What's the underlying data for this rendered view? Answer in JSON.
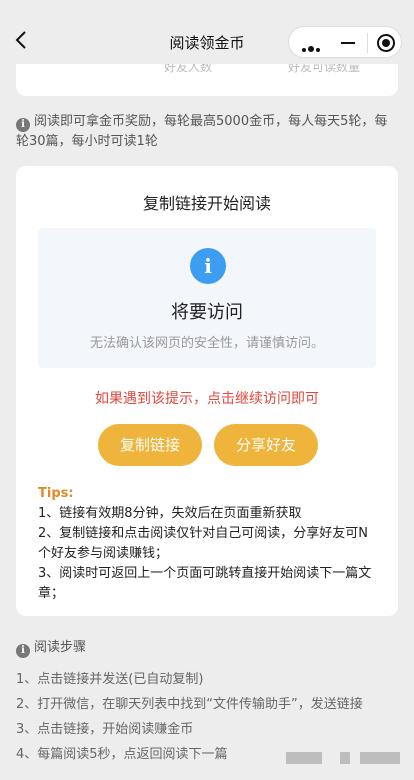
{
  "nav": {
    "title": "阅读领金币"
  },
  "stats": {
    "label_1": "好友人数",
    "label_2": "好友可读数量"
  },
  "info": {
    "text": "阅读即可拿金币奖励，每轮最高5000金币，每人每天5轮，每轮30篇，每小时可读1轮"
  },
  "card": {
    "title": "复制链接开始阅读",
    "warning": {
      "icon": "info-icon",
      "icon_glyph": "i",
      "title": "将要访问",
      "subtitle": "无法确认该网页的安全性，请谨慎访问。"
    },
    "hint": "如果遇到该提示，点击继续访问即可",
    "copy_button": "复制链接",
    "share_button": "分享好友",
    "tips_title": "Tips:",
    "tips": [
      "1、链接有效期8分钟，失效后在页面重新获取",
      "2、复制链接和点击阅读仅针对自己可阅读，分享好友可N个好友参与阅读赚钱；",
      "3、阅读时可返回上一个页面可跳转直接开始阅读下一篇文章；"
    ]
  },
  "steps": {
    "title": "阅读步骤",
    "items": [
      "1、点击链接并发送(已自动复制)",
      "2、打开微信，在聊天列表中找到“文件传输助手”，发送链接",
      "3、点击链接，开始阅读赚金币",
      "4、每篇阅读5秒，点返回阅读下一篇"
    ]
  },
  "colors": {
    "accent": "#eeb43b",
    "hint": "#e2463d",
    "tips": "#e08a2b",
    "info_blue": "#3d9df0"
  }
}
